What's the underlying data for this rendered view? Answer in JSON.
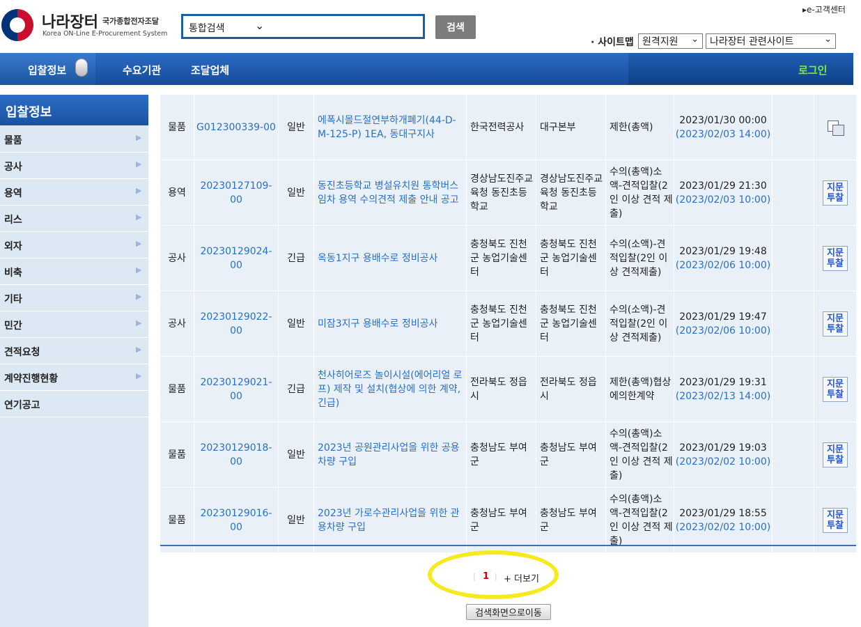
{
  "header": {
    "logo_title": "나라장터",
    "logo_sub": "국가종합전자조달",
    "logo_en": "Korea ON-Line E-Procurement System",
    "search_select": "통합검색",
    "search_button": "검색",
    "ecustomer": "▸e-고객센터",
    "sitemap": "· 사이트맵",
    "remote_support": "원격지원",
    "related_sites": "나라장터 관련사이트"
  },
  "nav": {
    "items": [
      "입찰정보",
      "수요기관",
      "조달업체"
    ],
    "login": "로그인"
  },
  "sidebar": {
    "title": "입찰정보",
    "items": [
      {
        "label": "물품",
        "arrow": true
      },
      {
        "label": "공사",
        "arrow": true
      },
      {
        "label": "용역",
        "arrow": true
      },
      {
        "label": "리스",
        "arrow": true
      },
      {
        "label": "외자",
        "arrow": true
      },
      {
        "label": "비축",
        "arrow": true
      },
      {
        "label": "기타",
        "arrow": true
      },
      {
        "label": "민간",
        "arrow": true
      },
      {
        "label": "견적요청",
        "arrow": true
      },
      {
        "label": "계약진행현황",
        "arrow": true
      },
      {
        "label": "연기공고",
        "arrow": false
      }
    ]
  },
  "rows": [
    {
      "type": "물품",
      "no": "G012300339-00",
      "kind": "일반",
      "name": "에폭시몰드절연부하개폐기(44-D-M-125-P) 1EA, 동대구지사",
      "org": "한국전력공사",
      "demand": "대구본부",
      "method": "제한(총액)",
      "open": "2023/01/30 00:00",
      "close": "(2023/02/03 14:00)",
      "action": "copy"
    },
    {
      "type": "용역",
      "no": "20230127109-00",
      "kind": "일반",
      "name": "동진초등학교 병설유치원 통학버스 임차 용역 수의견적 제출 안내 공고",
      "org": "경상남도진주교육청 동진초등학교",
      "demand": "경상남도진주교육청 동진초등학교",
      "method": "수의(총액)소액-견적입찰(2인 이상 견적 제출)",
      "open": "2023/01/29 21:30",
      "close": "(2023/02/03 10:00)",
      "action": "지문투찰"
    },
    {
      "type": "공사",
      "no": "20230129024-00",
      "kind": "긴급",
      "name": "옥동1지구 용배수로 정비공사",
      "org": "충청북도 진천군 농업기술센터",
      "demand": "충청북도 진천군 농업기술센터",
      "method": "수의(소액)-견적입찰(2인 이상 견적제출)",
      "open": "2023/01/29 19:48",
      "close": "(2023/02/06 10:00)",
      "action": "지문투찰"
    },
    {
      "type": "공사",
      "no": "20230129022-00",
      "kind": "일반",
      "name": "미잠3지구 용배수로 정비공사",
      "org": "충청북도 진천군 농업기술센터",
      "demand": "충청북도 진천군 농업기술센터",
      "method": "수의(소액)-견적입찰(2인 이상 견적제출)",
      "open": "2023/01/29 19:47",
      "close": "(2023/02/06 10:00)",
      "action": "지문투찰"
    },
    {
      "type": "물품",
      "no": "20230129021-00",
      "kind": "긴급",
      "name": "천사히어로즈 놀이시설(에어리얼 로프) 제작 및 설치(협상에 의한 계약, 긴급)",
      "org": "전라북도 정읍시",
      "demand": "전라북도 정읍시",
      "method": "제한(총액)협상에의한계약",
      "open": "2023/01/29 19:31",
      "close": "(2023/02/13 14:00)",
      "action": "지문투찰"
    },
    {
      "type": "물품",
      "no": "20230129018-00",
      "kind": "일반",
      "name": "2023년 공원관리사업을 위한 공용차량 구입",
      "org": "충청남도 부여군",
      "demand": "충청남도 부여군",
      "method": "수의(총액)소액-견적입찰(2인 이상 견적 제출)",
      "open": "2023/01/29 19:03",
      "close": "(2023/02/02 10:00)",
      "action": "지문투찰"
    },
    {
      "type": "물품",
      "no": "20230129016-00",
      "kind": "일반",
      "name": "2023년 가로수관리사업을 위한 관용차량 구입",
      "org": "충청남도 부여군",
      "demand": "충청남도 부여군",
      "method": "수의(총액)소액-견적입찰(2인 이상 견적 제출)",
      "open": "2023/01/29 18:55",
      "close": "(2023/02/02 10:00)",
      "action": "지문투찰"
    }
  ],
  "pagination": {
    "current": "1",
    "more": "+ 더보기",
    "goto_search": "검색화면으로이동"
  },
  "colors": {
    "nav_blue": "#1a52a0",
    "link_blue": "#2a6fc4",
    "row_bg": "#e9f0f7",
    "login_green": "#7eea3a",
    "highlight_yellow": "#f4ea1c"
  }
}
